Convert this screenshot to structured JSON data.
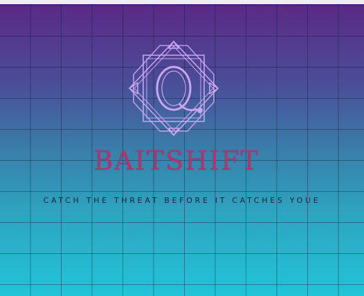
{
  "banner": {
    "brand_name": "BAITSHIFT",
    "tagline": "CATCH THE THREAT BEFORE IT CATCHES YOUE",
    "logo_letter": "Q",
    "logo_icon": "q-monogram-fishhook-emblem-icon"
  },
  "colors": {
    "gradient_top": "#5a2a86",
    "gradient_bottom": "#21c4d8",
    "brand_text": "#b3336f",
    "logo_stroke": "#c9a6f0",
    "tagline_text": "#16233a"
  }
}
